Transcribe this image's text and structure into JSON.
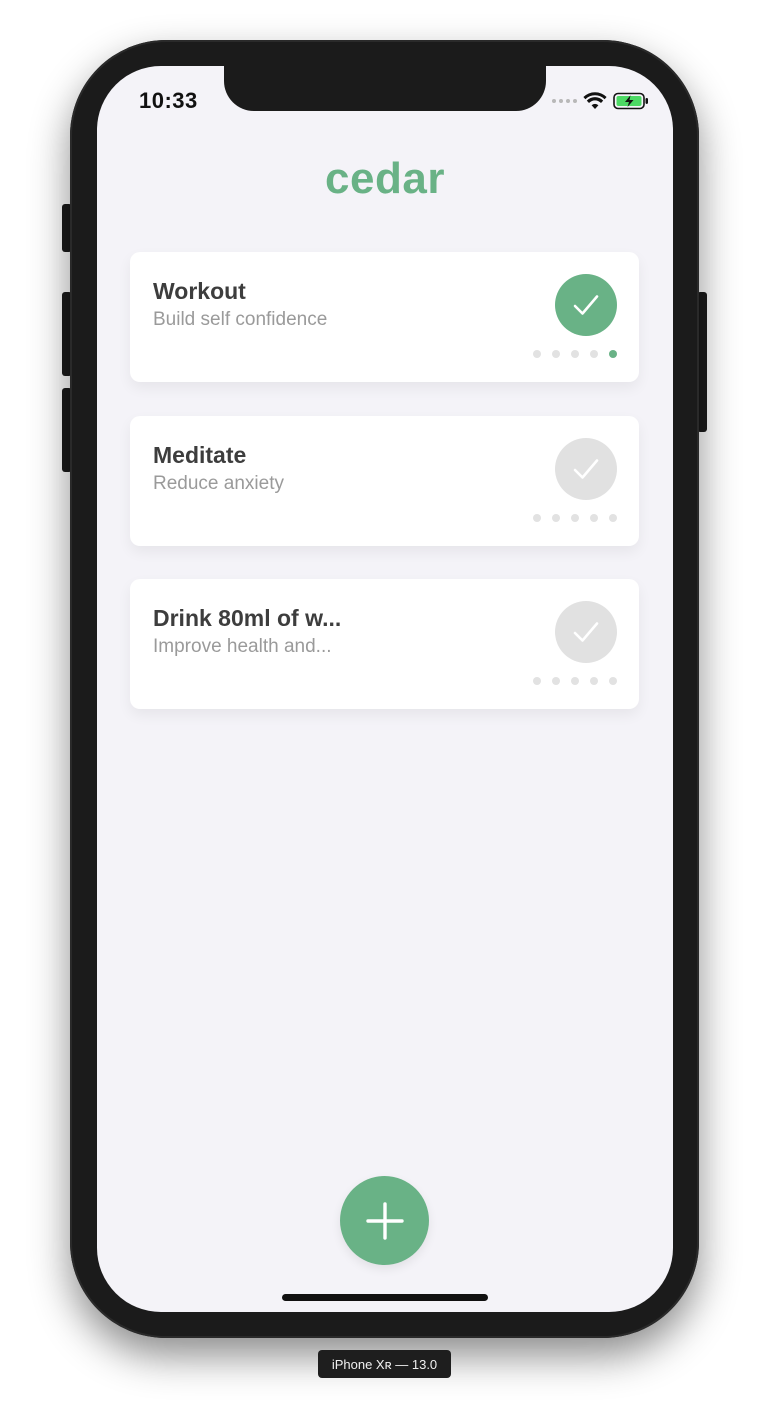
{
  "status_bar": {
    "time": "10:33"
  },
  "app": {
    "title": "cedar",
    "accent_color": "#69b286",
    "inactive_color": "#e1e1e1"
  },
  "habits": [
    {
      "title": "Workout",
      "subtitle": "Build self confidence",
      "done": true,
      "check_icon": "checkmark-icon",
      "streak_dots": [
        false,
        false,
        false,
        false,
        true
      ]
    },
    {
      "title": "Meditate",
      "subtitle": "Reduce anxiety",
      "done": false,
      "check_icon": "checkmark-icon",
      "streak_dots": [
        false,
        false,
        false,
        false,
        false
      ]
    },
    {
      "title": "Drink 80ml of w...",
      "subtitle": "Improve health and...",
      "done": false,
      "check_icon": "checkmark-icon",
      "streak_dots": [
        false,
        false,
        false,
        false,
        false
      ]
    }
  ],
  "fab": {
    "icon": "plus-icon"
  },
  "simulator": {
    "device_label": "iPhone Xʀ — 13.0"
  }
}
